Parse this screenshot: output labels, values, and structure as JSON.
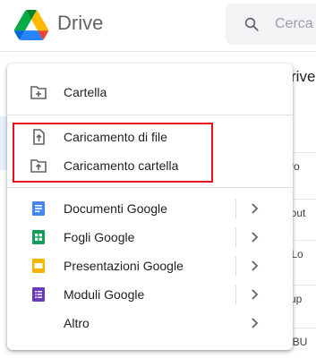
{
  "header": {
    "app_title": "Drive",
    "search_placeholder": "Cerca"
  },
  "background": {
    "column_title": "rive",
    "rows": [
      "ssro",
      "keout",
      "to Lo",
      "ckup",
      "W BU"
    ]
  },
  "menu": {
    "group1": [
      {
        "label": "Cartella",
        "icon": "new-folder-icon"
      }
    ],
    "group2": [
      {
        "label": "Caricamento di file",
        "icon": "file-upload-icon"
      },
      {
        "label": "Caricamento cartella",
        "icon": "folder-upload-icon"
      }
    ],
    "group3": [
      {
        "label": "Documenti Google",
        "icon": "google-docs-icon",
        "color": "#4285f4",
        "submenu": true
      },
      {
        "label": "Fogli Google",
        "icon": "google-sheets-icon",
        "color": "#0f9d58",
        "submenu": true
      },
      {
        "label": "Presentazioni Google",
        "icon": "google-slides-icon",
        "color": "#f4b400",
        "submenu": true
      },
      {
        "label": "Moduli Google",
        "icon": "google-forms-icon",
        "color": "#673ab7",
        "submenu": true
      },
      {
        "label": "Altro",
        "icon": "",
        "submenu": true
      }
    ]
  },
  "colors": {
    "highlight": "#e8101b",
    "accent": "#1a73e8"
  }
}
